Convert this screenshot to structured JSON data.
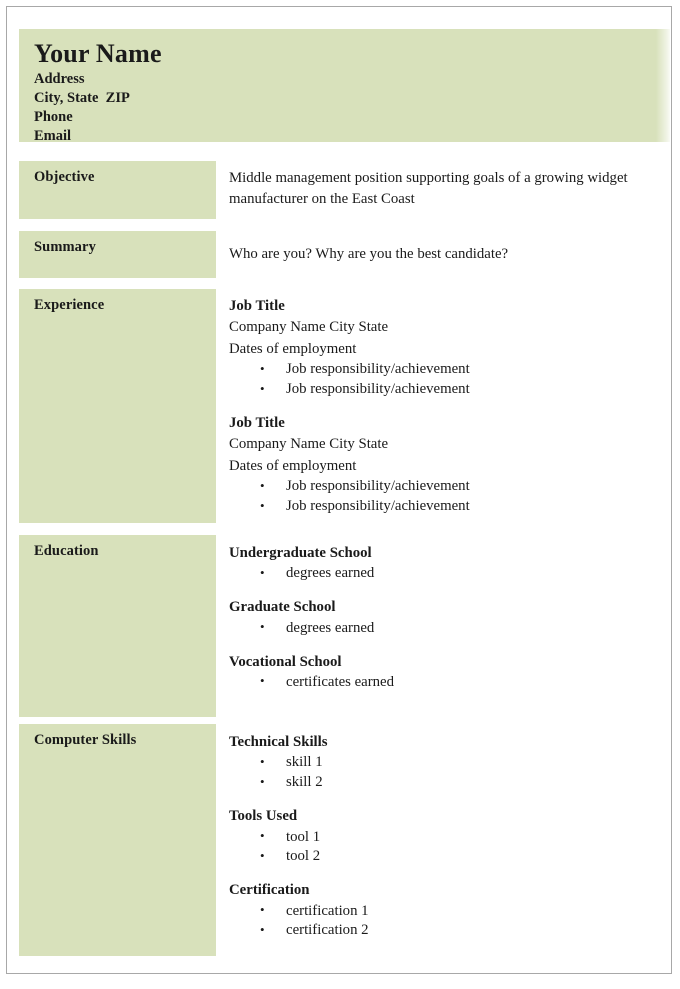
{
  "theme": {
    "accent_green": "#d8e1bb",
    "page_border": "#a8a8a8",
    "text": "#1a1a1a"
  },
  "header": {
    "name": "Your Name",
    "address": "Address",
    "city_state_zip": "City, State  ZIP",
    "phone": "Phone",
    "email": "Email"
  },
  "sections": {
    "objective": {
      "label": "Objective",
      "text": "Middle management position supporting goals of a growing widget manufacturer on the East Coast"
    },
    "summary": {
      "label": "Summary",
      "text": "Who are you? Why are you the best candidate?"
    },
    "experience": {
      "label": "Experience",
      "entries": [
        {
          "job_title": "Job Title",
          "company": "Company Name   City  State",
          "dates": "Dates of employment",
          "bullets": [
            "Job responsibility/achievement",
            "Job responsibility/achievement"
          ]
        },
        {
          "job_title": "Job Title",
          "company": "Company Name   City  State",
          "dates": "Dates of employment",
          "bullets": [
            "Job responsibility/achievement",
            "Job responsibility/achievement"
          ]
        }
      ]
    },
    "education": {
      "label": "Education",
      "groups": [
        {
          "heading": "Undergraduate School",
          "bullets": [
            "degrees earned"
          ]
        },
        {
          "heading": "Graduate School",
          "bullets": [
            "degrees earned"
          ]
        },
        {
          "heading": "Vocational School",
          "bullets": [
            "certificates earned"
          ]
        }
      ]
    },
    "computer_skills": {
      "label": "Computer Skills",
      "groups": [
        {
          "heading": "Technical Skills",
          "bullets": [
            "skill 1",
            "skill 2"
          ]
        },
        {
          "heading": "Tools Used",
          "bullets": [
            "tool 1",
            "tool 2"
          ]
        },
        {
          "heading": "Certification",
          "bullets": [
            "certification 1",
            "certification 2"
          ]
        }
      ]
    }
  }
}
